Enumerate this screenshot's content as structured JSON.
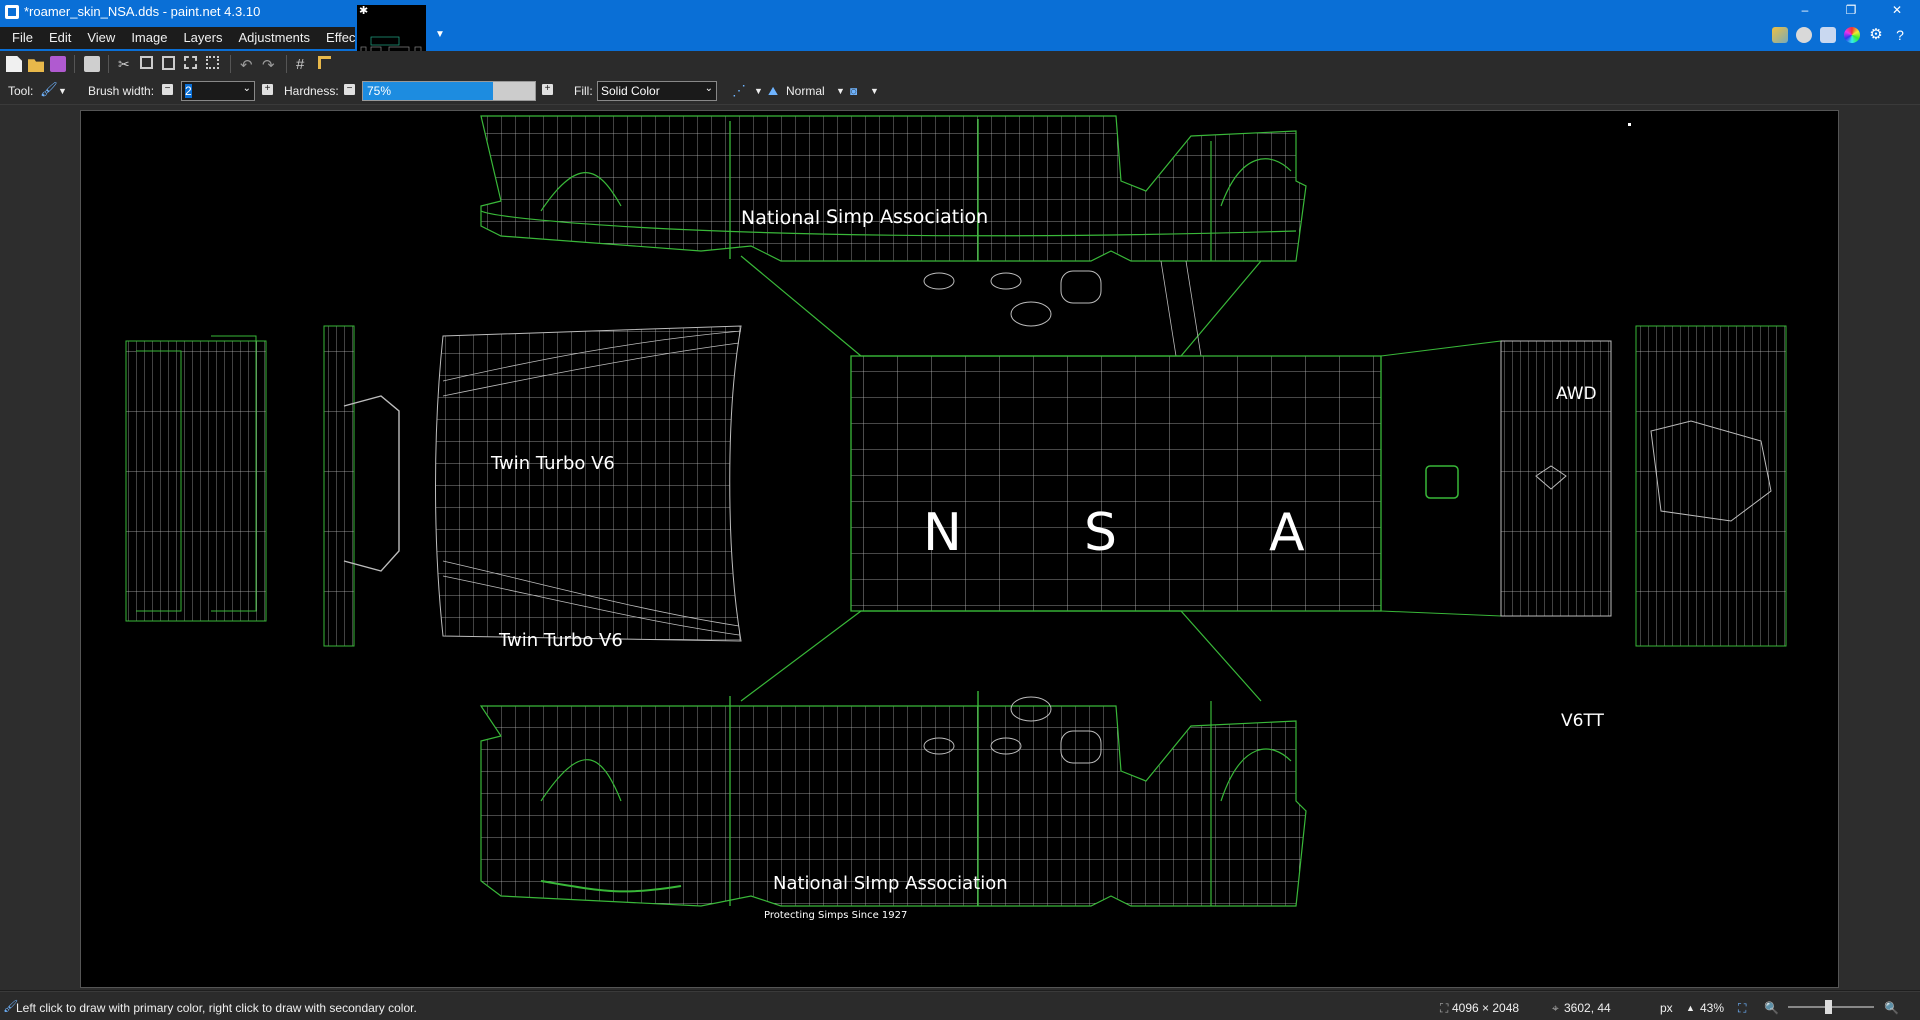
{
  "window": {
    "title": "*roamer_skin_NSA.dds - paint.net 4.3.10",
    "controls": [
      "–",
      "❐",
      "✕"
    ]
  },
  "menu": [
    "File",
    "Edit",
    "View",
    "Image",
    "Layers",
    "Adjustments",
    "Effects"
  ],
  "toolbar": {
    "tool_label": "Tool:",
    "brush_width_label": "Brush width:",
    "brush_width_value": "2",
    "hardness_label": "Hardness:",
    "hardness_value": "75%",
    "fill_label": "Fill:",
    "fill_value": "Solid Color",
    "blend_mode": "Normal"
  },
  "canvas": {
    "texts": {
      "national_simp_top_a": "National",
      "national_simp_top_b": "Simp Association",
      "twin_turbo_1": "Twin Turbo V6",
      "twin_turbo_2": "Twin Turbo V6",
      "n": "N",
      "s": "S",
      "a": "A",
      "awd": "AWD",
      "v6tt": "V6TT",
      "national_simp_bottom": "National SImp Association",
      "protecting": "Protecting Simps Since 1927"
    }
  },
  "status": {
    "hint": "Left click to draw with primary color, right click to draw with secondary color.",
    "image_size": "4096 × 2048",
    "cursor_pos": "3602, 44",
    "units": "px",
    "zoom": "43%"
  },
  "colors": {
    "accent": "#0a6fd6",
    "wire_green": "#2fa82f",
    "wire_white": "#cfcfcf"
  }
}
